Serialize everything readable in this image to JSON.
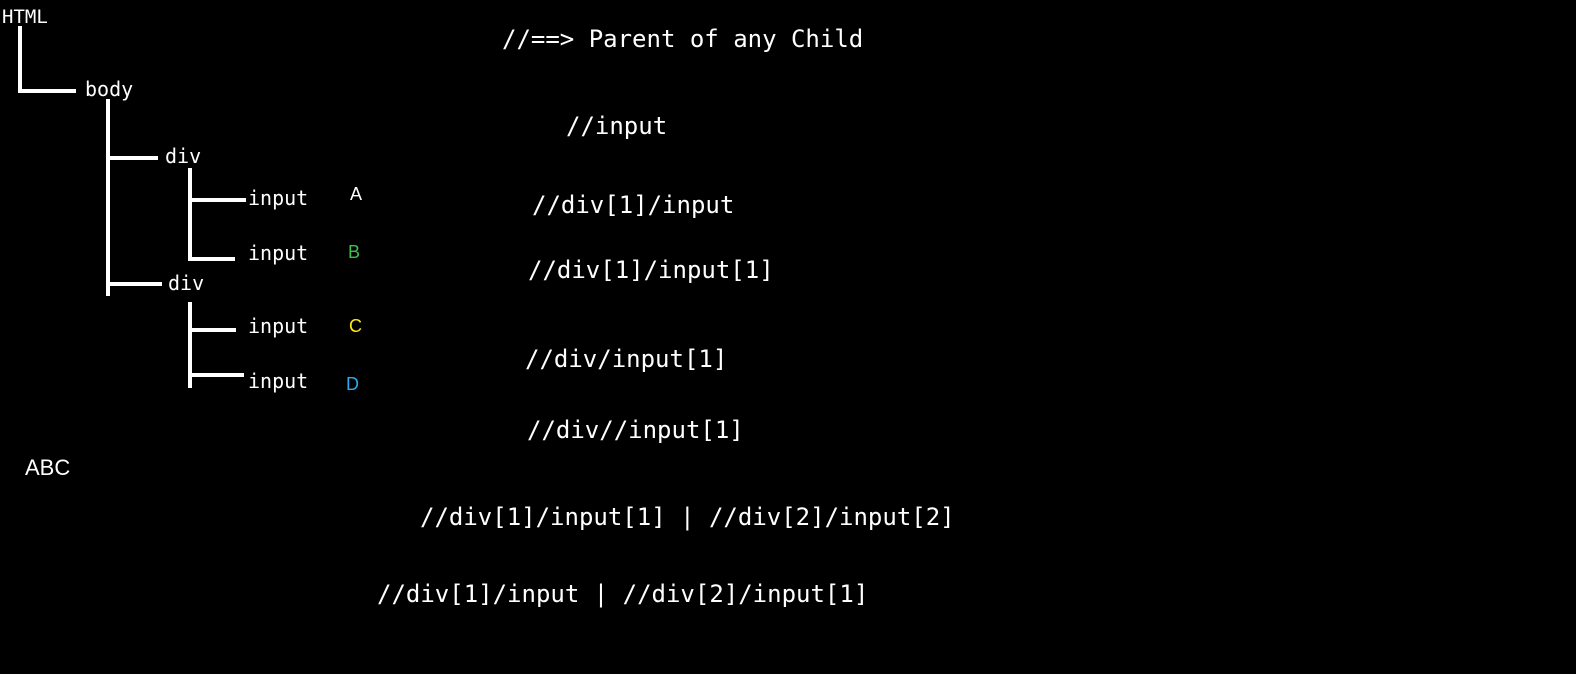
{
  "tree": {
    "html": "HTML",
    "body": "body",
    "div_1": "div",
    "input_a": "input",
    "input_b": "input",
    "div_2": "div",
    "input_c": "input",
    "input_d": "input"
  },
  "labels": {
    "a": {
      "text": "A",
      "color": "#ffffff"
    },
    "b": {
      "text": "B",
      "color": "#3cc14e"
    },
    "c": {
      "text": "C",
      "color": "#ffe81a"
    },
    "d": {
      "text": "D",
      "color": "#2ea8f0"
    }
  },
  "note": "ABC",
  "xpaths": [
    "//==> Parent of any Child",
    "//input",
    "//div[1]/input",
    "//div[1]/input[1]",
    "//div/input[1]",
    "//div//input[1]",
    "//div[1]/input[1] | //div[2]/input[2]",
    "//div[1]/input | //div[2]/input[1]"
  ]
}
